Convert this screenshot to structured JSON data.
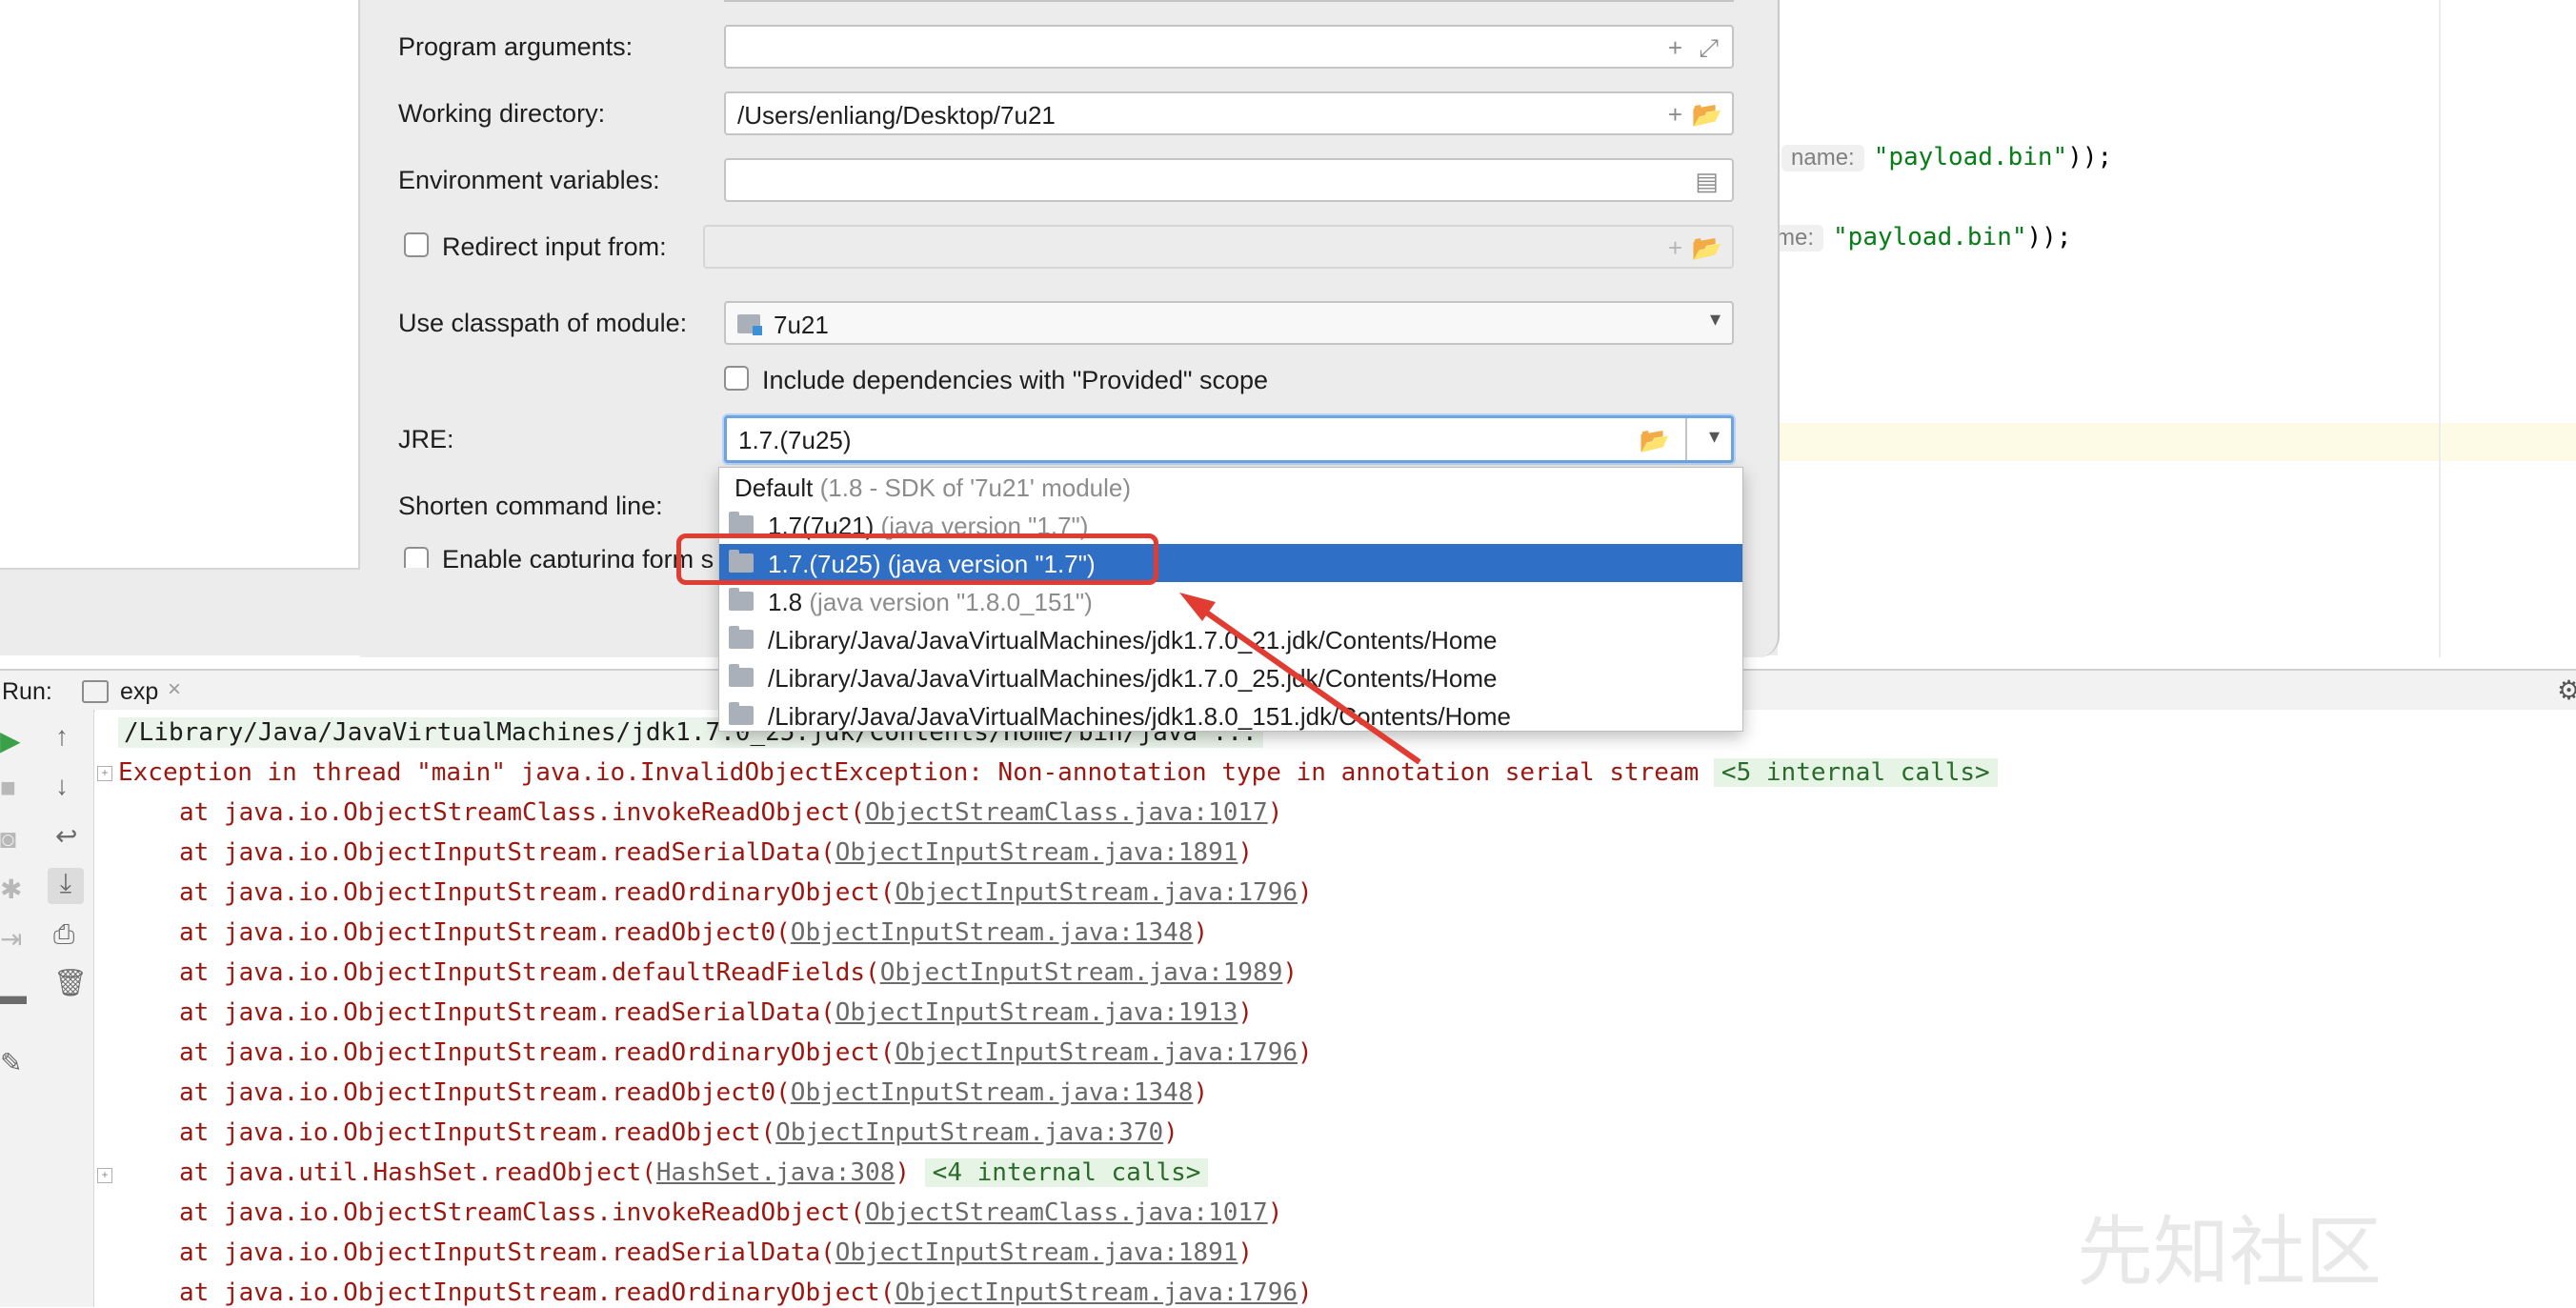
{
  "editor": {
    "line1": {
      "hint": "name:",
      "string": "\"payload.bin\"",
      "suffix": "));"
    },
    "line2": {
      "hint": "me:",
      "string": "\"payload.bin\"",
      "suffix": "));"
    }
  },
  "form": {
    "program_arguments": {
      "label": "Program arguments:",
      "value": ""
    },
    "working_directory": {
      "label": "Working directory:",
      "value": "/Users/enliang/Desktop/7u21"
    },
    "environment_variables": {
      "label": "Environment variables:",
      "value": ""
    },
    "redirect_input": {
      "label": "Redirect input from:",
      "checked": false,
      "value": ""
    },
    "classpath_module": {
      "label": "Use classpath of module:",
      "value": "7u21"
    },
    "include_provided": {
      "label": "Include dependencies with \"Provided\" scope",
      "checked": false
    },
    "jre": {
      "label": "JRE:",
      "value": "1.7.(7u25)"
    },
    "shorten_command_line": {
      "label": "Shorten command line:"
    },
    "enable_capturing": {
      "label": "Enable capturing form s",
      "checked": false
    }
  },
  "jre_options": [
    {
      "main": "Default",
      "hint": " (1.8 - SDK of '7u21' module)",
      "icon": "none",
      "selected": false
    },
    {
      "main": "1.7(7u21)",
      "hint": " (java version \"1.7\")",
      "icon": "folder-icon",
      "selected": false
    },
    {
      "main": "1.7.(7u25)",
      "hint": " (java version \"1.7\")",
      "icon": "folder-icon",
      "selected": true
    },
    {
      "main": "1.8",
      "hint": " (java version \"1.8.0_151\")",
      "icon": "folder-icon",
      "selected": false
    },
    {
      "main": "/Library/Java/JavaVirtualMachines/jdk1.7.0_21.jdk/Contents/Home",
      "hint": "",
      "icon": "folder-icon",
      "selected": false
    },
    {
      "main": "/Library/Java/JavaVirtualMachines/jdk1.7.0_25.jdk/Contents/Home",
      "hint": "",
      "icon": "folder-icon",
      "selected": false
    },
    {
      "main": "/Library/Java/JavaVirtualMachines/jdk1.8.0_151.jdk/Contents/Home",
      "hint": "",
      "icon": "folder-icon",
      "selected": false
    }
  ],
  "run": {
    "label": "Run:",
    "tab": "exp",
    "command": "/Library/Java/JavaVirtualMachines/jdk1.7.0_25.jdk/Contents/Home/bin/java ...",
    "exception": "Exception in thread \"main\" java.io.InvalidObjectException: Non-annotation type in annotation serial stream",
    "exception_internal": "<5 internal calls>",
    "trace": [
      {
        "pre": "at java.io.ObjectStreamClass.invokeReadObject(",
        "link": "ObjectStreamClass.java:1017",
        "post": ")",
        "internal": ""
      },
      {
        "pre": "at java.io.ObjectInputStream.readSerialData(",
        "link": "ObjectInputStream.java:1891",
        "post": ")",
        "internal": ""
      },
      {
        "pre": "at java.io.ObjectInputStream.readOrdinaryObject(",
        "link": "ObjectInputStream.java:1796",
        "post": ")",
        "internal": ""
      },
      {
        "pre": "at java.io.ObjectInputStream.readObject0(",
        "link": "ObjectInputStream.java:1348",
        "post": ")",
        "internal": ""
      },
      {
        "pre": "at java.io.ObjectInputStream.defaultReadFields(",
        "link": "ObjectInputStream.java:1989",
        "post": ")",
        "internal": ""
      },
      {
        "pre": "at java.io.ObjectInputStream.readSerialData(",
        "link": "ObjectInputStream.java:1913",
        "post": ")",
        "internal": ""
      },
      {
        "pre": "at java.io.ObjectInputStream.readOrdinaryObject(",
        "link": "ObjectInputStream.java:1796",
        "post": ")",
        "internal": ""
      },
      {
        "pre": "at java.io.ObjectInputStream.readObject0(",
        "link": "ObjectInputStream.java:1348",
        "post": ")",
        "internal": ""
      },
      {
        "pre": "at java.io.ObjectInputStream.readObject(",
        "link": "ObjectInputStream.java:370",
        "post": ")",
        "internal": ""
      },
      {
        "pre": "at java.util.HashSet.readObject(",
        "link": "HashSet.java:308",
        "post": ")",
        "internal": "<4 internal calls>"
      },
      {
        "pre": "at java.io.ObjectStreamClass.invokeReadObject(",
        "link": "ObjectStreamClass.java:1017",
        "post": ")",
        "internal": ""
      },
      {
        "pre": "at java.io.ObjectInputStream.readSerialData(",
        "link": "ObjectInputStream.java:1891",
        "post": ")",
        "internal": ""
      },
      {
        "pre": "at java.io.ObjectInputStream.readOrdinaryObject(",
        "link": "ObjectInputStream.java:1796",
        "post": ")",
        "internal": ""
      }
    ]
  },
  "watermark": "先知社区",
  "colors": {
    "selection": "#2f6fc6",
    "annotation": "#e03c31",
    "error_text": "#9d1710",
    "string": "#067d17"
  }
}
